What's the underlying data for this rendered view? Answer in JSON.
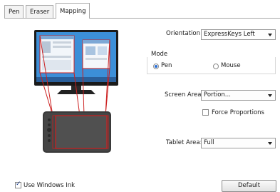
{
  "tabs": [
    {
      "label": "Pen",
      "active": false
    },
    {
      "label": "Eraser",
      "active": false
    },
    {
      "label": "Mapping",
      "active": true
    }
  ],
  "orientation": {
    "label": "Orientation:",
    "value": "ExpressKeys Left"
  },
  "mode": {
    "label": "Mode",
    "options": [
      {
        "label": "Pen",
        "selected": true
      },
      {
        "label": "Mouse",
        "selected": false
      }
    ]
  },
  "screen_area": {
    "label": "Screen Area:",
    "value": "Portion..."
  },
  "force_proportions": {
    "label": "Force Proportions",
    "checked": false
  },
  "tablet_area": {
    "label": "Tablet Area:",
    "value": "Full"
  },
  "use_windows_ink": {
    "label": "Use Windows Ink",
    "checked": true
  },
  "default_button": {
    "label": "Default"
  },
  "colors": {
    "mapping_outline": "#cc2020",
    "monitor_bezel": "#1a1a1a",
    "radio_accent": "#2a6fd6"
  }
}
